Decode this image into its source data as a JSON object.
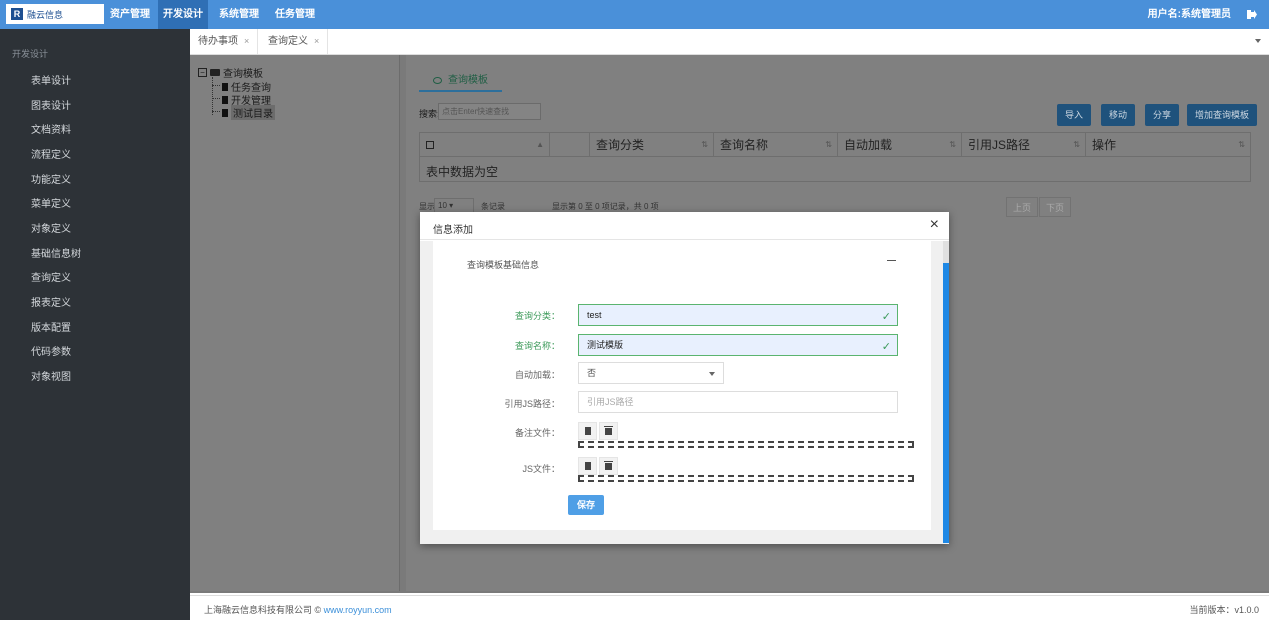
{
  "brand": {
    "logo_mark": "R",
    "logo_text": "融云信息"
  },
  "topnav": {
    "items": [
      "资产管理",
      "开发设计",
      "系统管理",
      "任务管理"
    ],
    "user": "用户名:系统管理员"
  },
  "sidebar": {
    "title": "开发设计",
    "items": [
      "表单设计",
      "图表设计",
      "文档资料",
      "流程定义",
      "功能定义",
      "菜单定义",
      "对象定义",
      "基础信息树",
      "查询定义",
      "报表定义",
      "版本配置",
      "代码参数",
      "对象视图"
    ]
  },
  "tabs": [
    {
      "label": "待办事项",
      "close": "×"
    },
    {
      "label": "查询定义",
      "close": "×"
    }
  ],
  "tree": {
    "root": "查询模板",
    "toggle": "−",
    "children": [
      "任务查询",
      "开发管理",
      "测试目录"
    ]
  },
  "main": {
    "tab": "查询模板",
    "search_label": "搜索:",
    "search_placeholder": "点击Enter快速查找",
    "buttons": [
      "导入",
      "移动",
      "分享",
      "增加查询模板"
    ],
    "columns": [
      "查询分类",
      "查询名称",
      "自动加载",
      "引用JS路径",
      "操作"
    ],
    "empty_text": "表中数据为空",
    "show_label": "显示",
    "page_size": "10",
    "records_label": "条记录",
    "range_info": "显示第 0 至 0 项记录，共 0 项",
    "prev": "上页",
    "next": "下页"
  },
  "modal": {
    "title": "信息添加",
    "close": "×",
    "section_title": "查询模板基础信息",
    "fields": {
      "category": {
        "label": "查询分类：",
        "value": "test"
      },
      "name": {
        "label": "查询名称：",
        "value": "测试模版"
      },
      "autoload": {
        "label": "自动加载：",
        "value": "否"
      },
      "js_path": {
        "label": "引用JS路径：",
        "placeholder": "引用JS路径"
      },
      "note_file": {
        "label": "备注文件："
      },
      "js_file": {
        "label": "JS文件："
      }
    },
    "save": "保存"
  },
  "footer": {
    "company": "上海融云信息科技有限公司 © ",
    "link": "www.royyun.com",
    "version": "当前版本：v1.0.0"
  },
  "colors": {
    "topbar": "#4a90d9",
    "sidebar": "#2d3237",
    "valid": "#3c9a5a",
    "accent": "#1e88e5"
  }
}
